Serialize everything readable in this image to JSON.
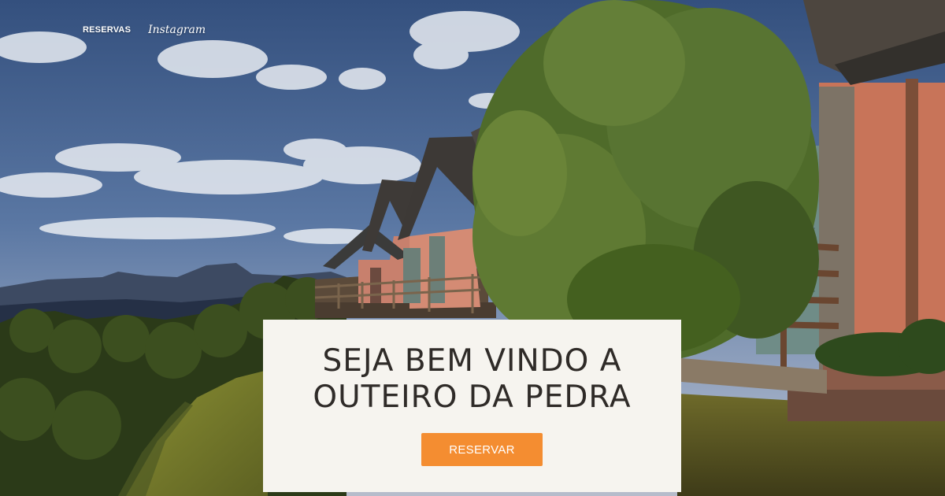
{
  "nav": {
    "reservas_label": "RESERVAS",
    "instagram_label": "Instagram"
  },
  "welcome": {
    "title_line1": "SEJA BEM VINDO A",
    "title_line2": "OUTEIRO DA PEDRA",
    "reserve_button_label": "RESERVAR"
  },
  "colors": {
    "accent": "#f48d31",
    "card_background": "#f6f4ef",
    "title_text": "#2f2b28",
    "nav_text": "#ffffff"
  }
}
